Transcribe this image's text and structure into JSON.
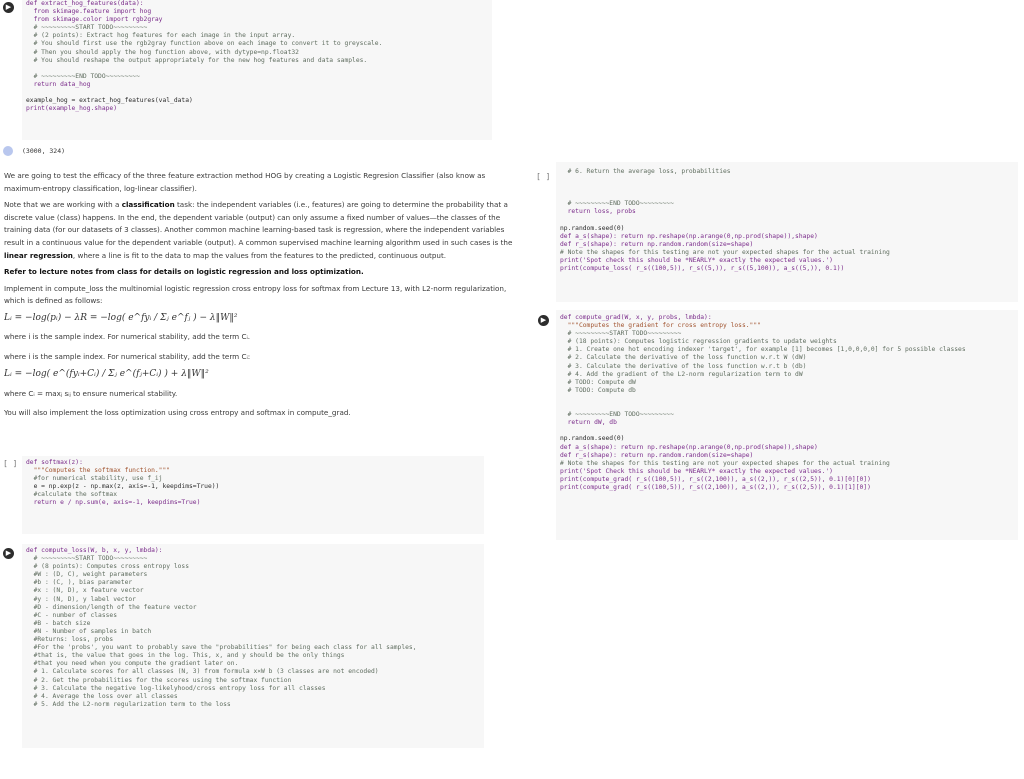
{
  "cell_hog": {
    "lines": [
      "def extract_hog_features(data):",
      "  from skimage.feature import hog",
      "  from skimage.color import rgb2gray",
      "  # ~~~~~~~~~START TODO~~~~~~~~~",
      "  # (2 points): Extract hog features for each image in the input array.",
      "  # You should first use the rgb2gray function above on each image to convert it to greyscale.",
      "  # Then you should apply the hog function above, with dytype=np.float32",
      "  # You should reshape the output appropriately for the new hog features and data samples.",
      "",
      "  # ~~~~~~~~~END TODO~~~~~~~~~",
      "  return data_hog",
      "",
      "example_hog = extract_hog_features(val_data)",
      "print(example_hog.shape)"
    ],
    "output": "(3000, 324)"
  },
  "markdown": {
    "p1": "We are going to test the efficacy of the three feature extraction method HOG by creating a Logistic Regresion Classifier (also know as maximum-entropy classification, log-linear classifier).",
    "p2a": "Note that we are working with a ",
    "p2b": "classification",
    "p2c": " task: the independent variables (i.e., features) are going to determine the probability that a discrete value (class) happens. In the end, the dependent variable (output) can only assume a fixed number of values—the classes of the training data (for our datasets of 3 classes). Another common machine learning-based task is regression, where the independent variables result in a continuous value for the dependent variable (output). A common supervised machine learning algorithm used in such cases is the ",
    "p2d": "linear regression",
    "p2e": ", where a line is fit to the data to map the values from the features to the predicted, continuous output.",
    "p3": "Refer to lecture notes from class for details on logistic regression and loss optimization.",
    "p4": "Implement in compute_loss the multinomial logistic regression cross entropy loss for softmax from Lecture 13, with L2-norm regularization, which is defined as follows:",
    "eq1": "Lᵢ = −log(pᵢ) − λR = −log( e^fyᵢ / Σⱼ e^fⱼ ) − λ‖W‖²",
    "p5": "where i is the sample index. For numerical stability, add the term Cᵢ.",
    "p6": "where i is the sample index. For numerical stability, add the term Cᵢ:",
    "eq2": "Lᵢ = −log( e^(fyᵢ+Cᵢ) / Σⱼ e^(fⱼ+Cᵢ) ) + λ‖W‖²",
    "p7": "where Cᵢ = maxⱼ sᵢⱼ to ensure numerical stability.",
    "p8": "You will also implement the loss optimization using cross entropy and softmax in compute_grad."
  },
  "cell_softmax": {
    "bracket": "[ ]",
    "lines": [
      "def softmax(z):",
      "  \"\"\"Computes the softmax function.\"\"\"",
      "  #for numerical stability, use f_ij",
      "  e = np.exp(z - np.max(z, axis=-1, keepdims=True))",
      "  #calculate the softmax",
      "  return e / np.sum(e, axis=-1, keepdims=True)"
    ]
  },
  "cell_loss": {
    "lines": [
      "def compute_loss(W, b, x, y, lmbda):",
      "  # ~~~~~~~~~START TODO~~~~~~~~~",
      "  # (8 points): Computes cross entropy loss",
      "  #W : (D, C), weight parameters",
      "  #b : (C, ), bias parameter",
      "  #x : (N, D), x feature vector",
      "  #y : (N, D), y label vector",
      "  #D - dimension/length of the feature vector",
      "  #C - number of classes",
      "  #B - batch size",
      "  #N - Number of samples in batch",
      "  #Returns: loss, probs",
      "  #For the 'probs', you want to probably save the \"probabilities\" for being each class for all samples,",
      "  #that is, the value that goes in the log. This, x, and y should be the only things",
      "  #that you need when you compute the gradient later on.",
      "  # 1. Calculate scores for all classes (N, 3) from formula x×W b (3 classes are not encoded)",
      "  # 2. Get the probabilities for the scores using the softmax function",
      "  # 3. Calculate the negative log-likelyhood/cross entropy loss for all classes",
      "  # 4. Average the loss over all classes",
      "  # 5. Add the L2-norm regularization term to the loss"
    ]
  },
  "cell_right_top": {
    "bracket": "[ ]",
    "lines": [
      "  # 6. Return the average loss, probabilities",
      "",
      "",
      "",
      "  # ~~~~~~~~~END TODO~~~~~~~~~",
      "  return loss, probs",
      "",
      "np.random.seed(0)",
      "def a_s(shape): return np.reshape(np.arange(0,np.prod(shape)),shape)",
      "def r_s(shape): return np.random.random(size=shape)",
      "# Note the shapes for this testing are not your expected shapes for the actual training",
      "print('Spot check this should be *NEARLY* exactly the expected values.')",
      "print(compute_loss( r_s((100,5)), r_s((5,)), r_s((5,100)), a_s((5,)), 0.1))"
    ]
  },
  "cell_grad": {
    "lines": [
      "def compute_grad(W, x, y, probs, lmbda):",
      "  \"\"\"Computes the gradient for cross entropy loss.\"\"\"",
      "  # ~~~~~~~~~START TODO~~~~~~~~~",
      "  # (18 points): Computes logistic regression gradients to update weights",
      "  # 1. Create one hot encoding indexer 'target', for example [1] becomes [1,0,0,0,0] for 5 possible classes",
      "  # 2. Calculate the derivative of the loss function w.r.t W (dW)",
      "  # 3. Calculate the derivative of the loss function w.r.t b (db)",
      "  # 4. Add the gradient of the L2-norm regularization term to dW",
      "  # TODO: Compute dW",
      "  # TODO: Compute db",
      "",
      "",
      "  # ~~~~~~~~~END TODO~~~~~~~~~",
      "  return dW, db",
      "",
      "np.random.seed(0)",
      "def a_s(shape): return np.reshape(np.arange(0,np.prod(shape)),shape)",
      "def r_s(shape): return np.random.random(size=shape)",
      "# Note the shapes for this testing are not your expected shapes for the actual training",
      "print('Spot Check this should be *NEARLY* exactly the expected values.')",
      "print(compute_grad( r_s((100,5)), r_s((2,100)), a_s((2,)), r_s((2,5)), 0.1)[0][0])",
      "print(compute_grad( r_s((100,5)), r_s((2,100)), a_s((2,)), r_s((2,5)), 0.1)[1][0])"
    ]
  }
}
